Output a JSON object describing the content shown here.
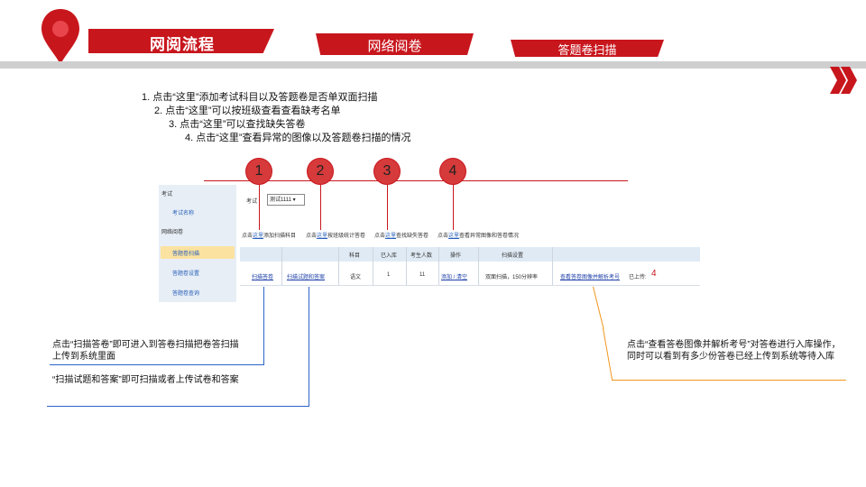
{
  "header": {
    "title": "网阅流程",
    "step_online": "网络阅卷",
    "step_scan": "答题卷扫描"
  },
  "instructions": [
    "1. 点击“这里”添加考试科目以及答题卷是否单双面扫描",
    "2. 点击“这里”可以按班级查看查看缺考名单",
    "3. 点击“这里”可以查找缺失答卷",
    "4. 点击“这里”查看异常的图像以及答题卷扫描的情况"
  ],
  "circles": [
    "1",
    "2",
    "3",
    "4"
  ],
  "screenshot": {
    "sidebar": {
      "group1": "考试",
      "group1_item": "考试名称",
      "group2": "网络阅卷",
      "items": [
        "答题卷扫描",
        "答题卷设置",
        "答题卷查询"
      ]
    },
    "exam_label": "考试",
    "exam_select": "测试1111",
    "links": [
      {
        "pre": "点击",
        "link": "这里",
        "post": "添加扫描科目"
      },
      {
        "pre": "点击",
        "link": "这里",
        "post": "按班级统计答卷"
      },
      {
        "pre": "点击",
        "link": "这里",
        "post": "查找缺失答卷"
      },
      {
        "pre": "点击",
        "link": "这里",
        "post": "查看异常图像和答卷情况"
      }
    ],
    "table": {
      "headers": [
        "科目",
        "已入库",
        "考生人数",
        "操作",
        "扫描设置"
      ],
      "row": {
        "scan": "扫描答卷",
        "scan_upload": "扫描试题和答案",
        "subject": "语文",
        "stored": "1",
        "students": "11",
        "ops": "添加 / 清空",
        "settings": "双面扫描，150分辨率",
        "view": "查看答卷图像并解析考号",
        "uploaded_label": "已上传:",
        "uploaded_count": "4"
      }
    }
  },
  "notes": {
    "scan": "点击“扫描答卷”即可进入到答卷扫描把卷答扫描上传到系统里面",
    "scan_upload": "“扫描试题和答案”即可扫描或者上传试卷和答案",
    "view": "点击“查看答卷图像并解析考号”对答卷进行入库操作，同时可以看到有多少份答卷已经上传到系统等待入库"
  },
  "colors": {
    "brand_red": "#c8161d",
    "link_blue": "#2860b8",
    "accent_orange": "#f0961e",
    "highlight": "#fbe2a0"
  }
}
